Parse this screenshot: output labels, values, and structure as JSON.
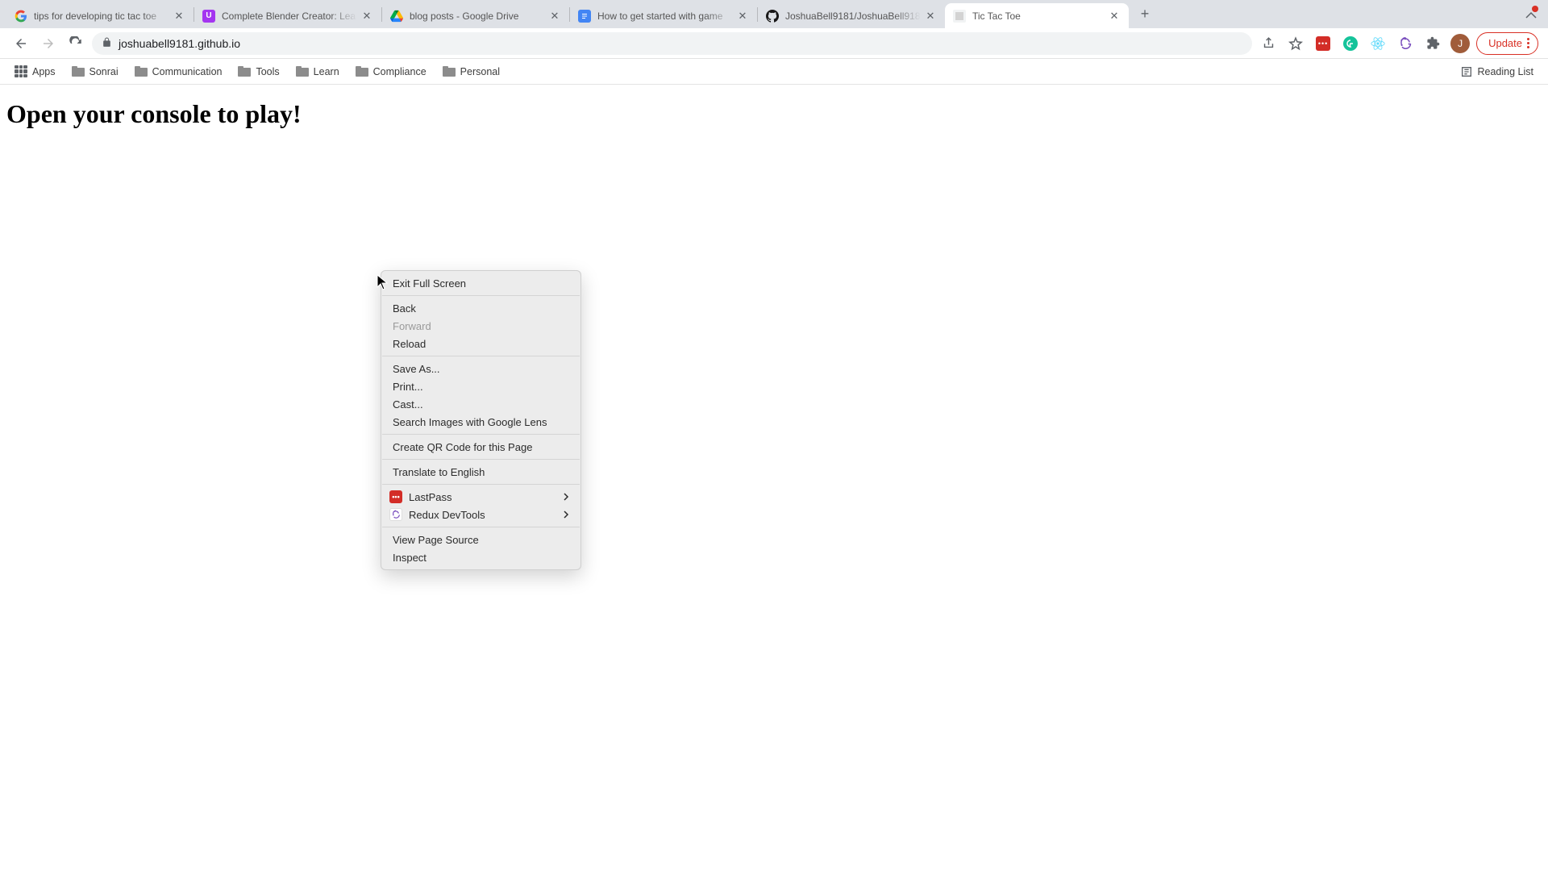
{
  "tabs": [
    {
      "title": "tips for developing tic tac toe",
      "active": false,
      "favicon": "google"
    },
    {
      "title": "Complete Blender Creator: Lea",
      "active": false,
      "favicon": "udemy"
    },
    {
      "title": "blog posts - Google Drive",
      "active": false,
      "favicon": "drive"
    },
    {
      "title": "How to get started with game",
      "active": false,
      "favicon": "docs"
    },
    {
      "title": "JoshuaBell9181/JoshuaBell918",
      "active": false,
      "favicon": "github"
    },
    {
      "title": "Tic Tac Toe",
      "active": true,
      "favicon": "page"
    }
  ],
  "address": {
    "url": "joshuabell9181.github.io"
  },
  "bookmarks": {
    "apps_label": "Apps",
    "folders": [
      "Sonrai",
      "Communication",
      "Tools",
      "Learn",
      "Compliance",
      "Personal"
    ],
    "reading_list_label": "Reading List"
  },
  "update_button_label": "Update",
  "avatar_initial": "J",
  "page_heading": "Open your console to play!",
  "context_menu": {
    "exit_fs": "Exit Full Screen",
    "back": "Back",
    "forward": "Forward",
    "reload": "Reload",
    "save_as": "Save As...",
    "print": "Print...",
    "cast": "Cast...",
    "lens": "Search Images with Google Lens",
    "qr": "Create QR Code for this Page",
    "translate": "Translate to English",
    "lastpass": "LastPass",
    "redux": "Redux DevTools",
    "view_source": "View Page Source",
    "inspect": "Inspect"
  }
}
